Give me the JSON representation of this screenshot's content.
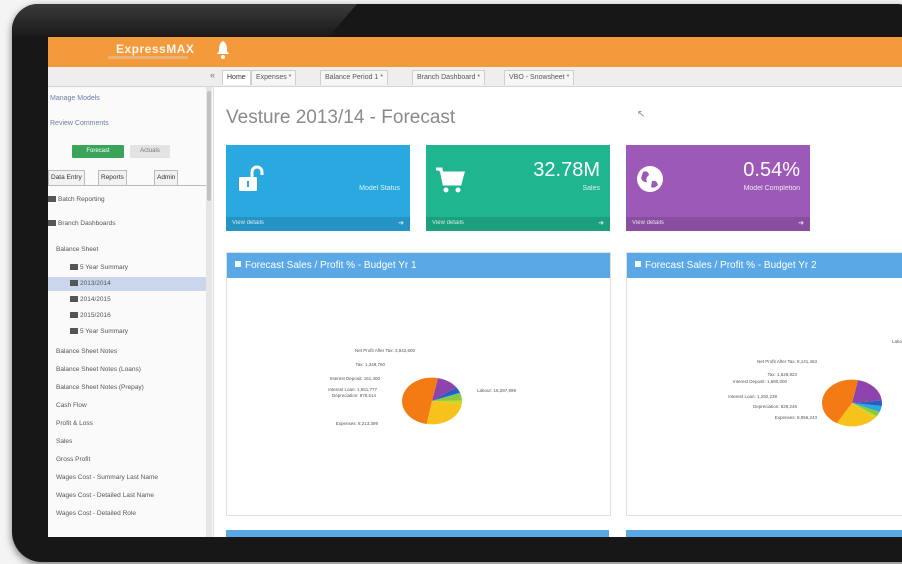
{
  "header": {
    "logo": "ExpressMAX"
  },
  "tabs": [
    {
      "label": "Home"
    },
    {
      "label": "Expenses *"
    },
    {
      "label": "Balance Period 1 *"
    },
    {
      "label": "Branch Dashboard *"
    },
    {
      "label": "VBO - Snowsheet *"
    }
  ],
  "sidebar": {
    "links": [
      "Manage Models",
      "Review Comments"
    ],
    "buttons": {
      "green": "Forecast",
      "gray": "Actuals"
    },
    "tabs": [
      "Data Entry",
      "Reports",
      "Admin"
    ],
    "sections": [
      "Batch Reporting",
      "Branch Dashboards"
    ],
    "tree": [
      {
        "label": "Balance Sheet",
        "selected": false
      },
      {
        "label": "5 Year Summary",
        "selected": false
      },
      {
        "label": "2013/2014",
        "selected": true
      },
      {
        "label": "2014/2015",
        "selected": false
      },
      {
        "label": "2015/2016",
        "selected": false
      },
      {
        "label": "5 Year Summary",
        "selected": false
      },
      {
        "label": "Balance Sheet Notes",
        "selected": false
      },
      {
        "label": "Balance Sheet Notes (Loans)",
        "selected": false
      },
      {
        "label": "Balance Sheet Notes (Prepay)",
        "selected": false
      },
      {
        "label": "Cash Flow",
        "selected": false
      },
      {
        "label": "Profit & Loss",
        "selected": false
      },
      {
        "label": "Sales",
        "selected": false
      },
      {
        "label": "Gross Profit",
        "selected": false
      },
      {
        "label": "Wages Cost - Summary Last Name",
        "selected": false
      },
      {
        "label": "Wages Cost - Detailed Last Name",
        "selected": false
      },
      {
        "label": "Wages Cost - Detailed Role",
        "selected": false
      }
    ]
  },
  "main": {
    "title": "Vesture 2013/14 - Forecast",
    "tiles": [
      {
        "value": "",
        "label": "Model Status",
        "more": "View details",
        "color": "#29a9e0",
        "icon": "unlock-icon"
      },
      {
        "value": "32.78M",
        "label": "Sales",
        "more": "View details",
        "color": "#1fb58f",
        "icon": "cart-icon"
      },
      {
        "value": "0.54%",
        "label": "Model Completion",
        "more": "View details",
        "color": "#9d59b7",
        "icon": "globe-icon"
      }
    ],
    "panels": [
      {
        "title": "Forecast Sales / Profit % - Budget Yr 1"
      },
      {
        "title": "Forecast Sales / Profit % - Budget Yr 2"
      }
    ]
  },
  "chart_data": [
    {
      "type": "pie",
      "slices": [
        {
          "label": "Net Profit After Tax: 3,842,600",
          "value": 3842600,
          "color": "#8e44ad"
        },
        {
          "label": "Tax: 1,348,760",
          "value": 1348760,
          "color": "#2b5fbd"
        },
        {
          "label": "Interest Deposit: 161,400",
          "value": 161400,
          "color": "#27a9e1"
        },
        {
          "label": "Interest Loan: 1,651,777",
          "value": 1651777,
          "color": "#8dc63f"
        },
        {
          "label": "Depreciation: 878,514",
          "value": 878514,
          "color": "#c9d81b"
        },
        {
          "label": "Expenses: 8,213,399",
          "value": 8213399,
          "color": "#f7c21b"
        },
        {
          "label": "Labour: 16,297,999",
          "value": 16297999,
          "color": "#f47b13"
        }
      ]
    },
    {
      "type": "pie",
      "slices": [
        {
          "label": "Net Profit After Tax: 8,141,463",
          "value": 8141463,
          "color": "#8e44ad"
        },
        {
          "label": "Tax: 1,628,923",
          "value": 1628923,
          "color": "#2b5fbd"
        },
        {
          "label": "Interest Deposit: 1,680,000",
          "value": 1680000,
          "color": "#27a9e1"
        },
        {
          "label": "Interest Loan: 1,292,239",
          "value": 1292239,
          "color": "#8dc63f"
        },
        {
          "label": "Depreciation: 829,246",
          "value": 829246,
          "color": "#c9d81b"
        },
        {
          "label": "Expenses: 8,956,243",
          "value": 8956243,
          "color": "#f7c21b"
        },
        {
          "label": "Labour",
          "value": 18200000,
          "color": "#f47b13"
        }
      ]
    }
  ]
}
